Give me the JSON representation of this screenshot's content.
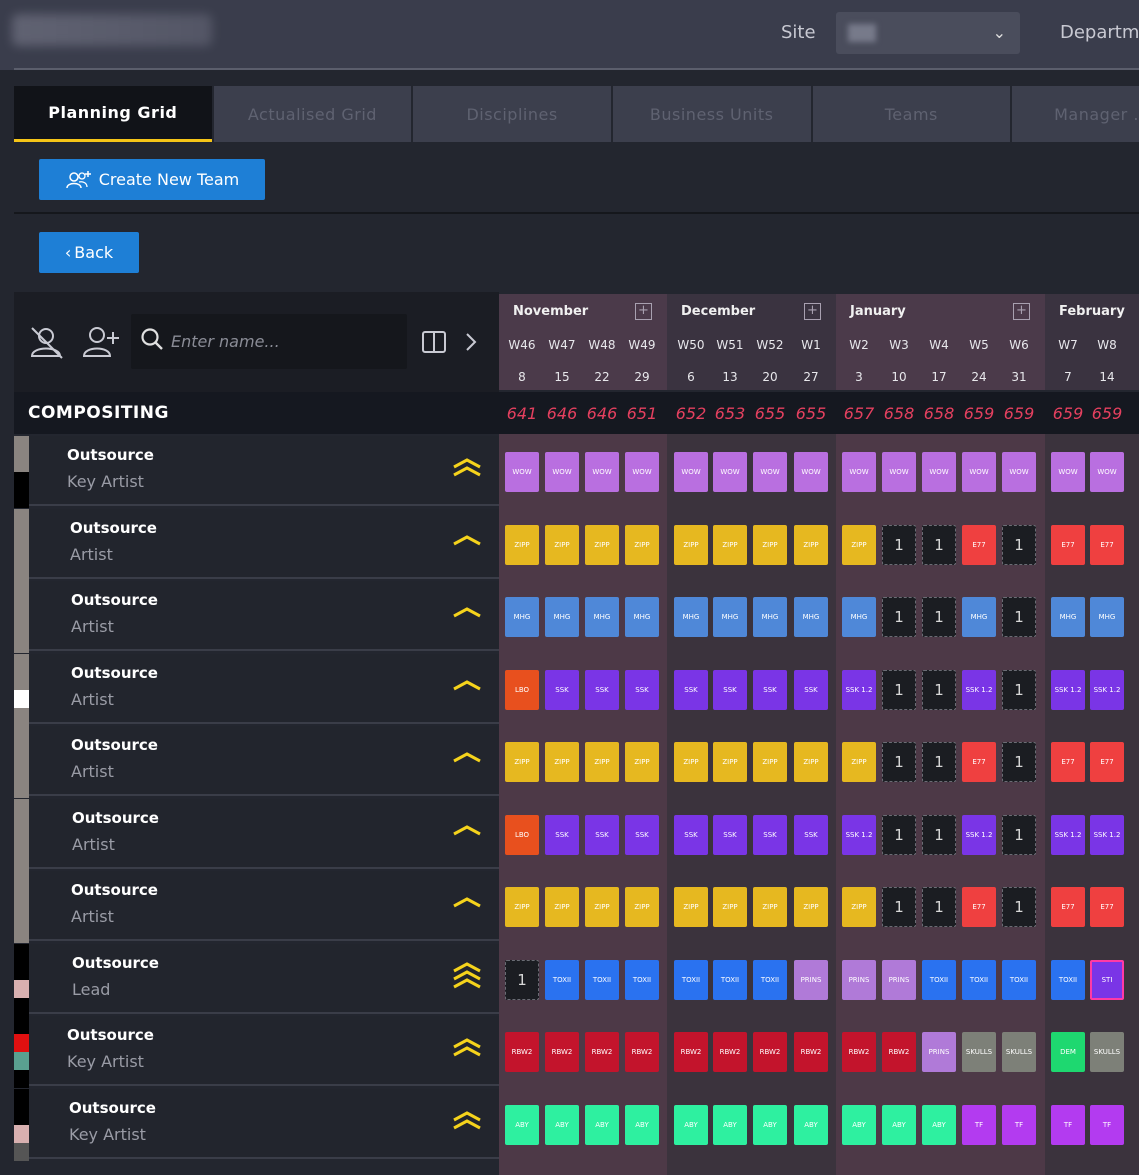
{
  "header": {
    "site_label": "Site",
    "dept_label": "Departme"
  },
  "tabs": [
    "Planning Grid",
    "Actualised Grid",
    "Disciplines",
    "Business Units",
    "Teams",
    "Manager ..."
  ],
  "buttons": {
    "create_team": "Create New Team",
    "back": "Back"
  },
  "search": {
    "placeholder": "Enter name..."
  },
  "months": [
    {
      "name": "November",
      "weeks": [
        "W46",
        "W47",
        "W48",
        "W49"
      ],
      "days": [
        "8",
        "15",
        "22",
        "29"
      ]
    },
    {
      "name": "December",
      "weeks": [
        "W50",
        "W51",
        "W52",
        "W1"
      ],
      "days": [
        "6",
        "13",
        "20",
        "27"
      ]
    },
    {
      "name": "January",
      "weeks": [
        "W2",
        "W3",
        "W4",
        "W5",
        "W6"
      ],
      "days": [
        "3",
        "10",
        "17",
        "24",
        "31"
      ]
    },
    {
      "name": "February",
      "weeks": [
        "W7",
        "W8"
      ],
      "days": [
        "7",
        "14"
      ]
    }
  ],
  "section": {
    "label": "COMPOSITING",
    "counts": [
      "641",
      "646",
      "646",
      "651",
      "652",
      "653",
      "655",
      "655",
      "657",
      "658",
      "658",
      "659",
      "659",
      "659",
      "659"
    ]
  },
  "colors": {
    "wow": "#b96fe0",
    "zipp": "#e6b820",
    "mhg": "#4f88d8",
    "lbo": "#e8501e",
    "ssk": "#7a35e6",
    "e77": "#ef4040",
    "toxi": "#2a72f0",
    "prins": "#b07ad8",
    "rbw": "#c3142c",
    "skulls": "#7d8078",
    "dem": "#1ed870",
    "aby": "#2ef0a0",
    "tf": "#b33bf0"
  },
  "rows": [
    {
      "name": "Outsource",
      "role": "Key Artist",
      "chevron": "double",
      "bars": [
        "#8a8480",
        "#8a8480",
        "#000000",
        "#000000"
      ],
      "cells": [
        [
          "WOW",
          "wow"
        ],
        [
          "WOW",
          "wow"
        ],
        [
          "WOW",
          "wow"
        ],
        [
          "WOW",
          "wow"
        ],
        [
          "WOW",
          "wow"
        ],
        [
          "WOW",
          "wow"
        ],
        [
          "WOW",
          "wow"
        ],
        [
          "WOW",
          "wow"
        ],
        [
          "WOW",
          "wow"
        ],
        [
          "WOW",
          "wow"
        ],
        [
          "WOW",
          "wow"
        ],
        [
          "WOW",
          "wow"
        ],
        [
          "WOW",
          "wow"
        ],
        [
          "WOW",
          "wow"
        ],
        [
          "WOW",
          "wow"
        ]
      ]
    },
    {
      "name": "Outsource",
      "role": "Artist",
      "chevron": "single",
      "bars": [
        "#8a8480",
        "#8a8480",
        "#8a8480",
        "#8a8480"
      ],
      "cells": [
        [
          "ZIPP",
          "zipp"
        ],
        [
          "ZIPP",
          "zipp"
        ],
        [
          "ZIPP",
          "zipp"
        ],
        [
          "ZIPP",
          "zipp"
        ],
        [
          "ZIPP",
          "zipp"
        ],
        [
          "ZIPP",
          "zipp"
        ],
        [
          "ZIPP",
          "zipp"
        ],
        [
          "ZIPP",
          "zipp"
        ],
        [
          "ZIPP",
          "zipp"
        ],
        [
          "1",
          "empty"
        ],
        [
          "1",
          "empty"
        ],
        [
          "E77",
          "e77"
        ],
        [
          "1",
          "empty"
        ],
        [
          "E77",
          "e77"
        ],
        [
          "E77",
          "e77"
        ]
      ]
    },
    {
      "name": "Outsource",
      "role": "Artist",
      "chevron": "single",
      "bars": [
        "#8a8480",
        "#8a8480",
        "#8a8480",
        "#8a8480"
      ],
      "cells": [
        [
          "MHG",
          "mhg"
        ],
        [
          "MHG",
          "mhg"
        ],
        [
          "MHG",
          "mhg"
        ],
        [
          "MHG",
          "mhg"
        ],
        [
          "MHG",
          "mhg"
        ],
        [
          "MHG",
          "mhg"
        ],
        [
          "MHG",
          "mhg"
        ],
        [
          "MHG",
          "mhg"
        ],
        [
          "MHG",
          "mhg"
        ],
        [
          "1",
          "empty"
        ],
        [
          "1",
          "empty"
        ],
        [
          "MHG",
          "mhg"
        ],
        [
          "1",
          "empty"
        ],
        [
          "MHG",
          "mhg"
        ],
        [
          "MHG",
          "mhg"
        ]
      ]
    },
    {
      "name": "Outsource",
      "role": "Artist",
      "chevron": "single",
      "bars": [
        "#8a8480",
        "#8a8480",
        "#ffffff",
        "#8a8480"
      ],
      "cells": [
        [
          "LBO",
          "lbo"
        ],
        [
          "SSK",
          "ssk"
        ],
        [
          "SSK",
          "ssk"
        ],
        [
          "SSK",
          "ssk"
        ],
        [
          "SSK",
          "ssk"
        ],
        [
          "SSK",
          "ssk"
        ],
        [
          "SSK",
          "ssk"
        ],
        [
          "SSK",
          "ssk"
        ],
        [
          "SSK 1.2",
          "ssk"
        ],
        [
          "1",
          "empty"
        ],
        [
          "1",
          "empty"
        ],
        [
          "SSK 1.2",
          "ssk"
        ],
        [
          "1",
          "empty"
        ],
        [
          "SSK 1.2",
          "ssk"
        ],
        [
          "SSK 1.2",
          "ssk"
        ]
      ]
    },
    {
      "name": "Outsource",
      "role": "Artist",
      "chevron": "single",
      "bars": [
        "#8a8480",
        "#8a8480",
        "#8a8480",
        "#8a8480"
      ],
      "cells": [
        [
          "ZIPP",
          "zipp"
        ],
        [
          "ZIPP",
          "zipp"
        ],
        [
          "ZIPP",
          "zipp"
        ],
        [
          "ZIPP",
          "zipp"
        ],
        [
          "ZIPP",
          "zipp"
        ],
        [
          "ZIPP",
          "zipp"
        ],
        [
          "ZIPP",
          "zipp"
        ],
        [
          "ZIPP",
          "zipp"
        ],
        [
          "ZIPP",
          "zipp"
        ],
        [
          "1",
          "empty"
        ],
        [
          "1",
          "empty"
        ],
        [
          "E77",
          "e77"
        ],
        [
          "1",
          "empty"
        ],
        [
          "E77",
          "e77"
        ],
        [
          "E77",
          "e77"
        ]
      ]
    },
    {
      "name": "Outsource",
      "role": "Artist",
      "chevron": "single",
      "bars": [
        "#8a8480",
        "#8a8480",
        "#8a8480",
        "#8a8480"
      ],
      "cells": [
        [
          "LBO",
          "lbo"
        ],
        [
          "SSK",
          "ssk"
        ],
        [
          "SSK",
          "ssk"
        ],
        [
          "SSK",
          "ssk"
        ],
        [
          "SSK",
          "ssk"
        ],
        [
          "SSK",
          "ssk"
        ],
        [
          "SSK",
          "ssk"
        ],
        [
          "SSK",
          "ssk"
        ],
        [
          "SSK 1.2",
          "ssk"
        ],
        [
          "1",
          "empty"
        ],
        [
          "1",
          "empty"
        ],
        [
          "SSK 1.2",
          "ssk"
        ],
        [
          "1",
          "empty"
        ],
        [
          "SSK 1.2",
          "ssk"
        ],
        [
          "SSK 1.2",
          "ssk"
        ]
      ]
    },
    {
      "name": "Outsource",
      "role": "Artist",
      "chevron": "single",
      "bars": [
        "#8a8480",
        "#8a8480",
        "#8a8480",
        "#8a8480"
      ],
      "cells": [
        [
          "ZIPP",
          "zipp"
        ],
        [
          "ZIPP",
          "zipp"
        ],
        [
          "ZIPP",
          "zipp"
        ],
        [
          "ZIPP",
          "zipp"
        ],
        [
          "ZIPP",
          "zipp"
        ],
        [
          "ZIPP",
          "zipp"
        ],
        [
          "ZIPP",
          "zipp"
        ],
        [
          "ZIPP",
          "zipp"
        ],
        [
          "ZIPP",
          "zipp"
        ],
        [
          "1",
          "empty"
        ],
        [
          "1",
          "empty"
        ],
        [
          "E77",
          "e77"
        ],
        [
          "1",
          "empty"
        ],
        [
          "E77",
          "e77"
        ],
        [
          "E77",
          "e77"
        ]
      ]
    },
    {
      "name": "Outsource",
      "role": "Lead",
      "chevron": "triple",
      "bars": [
        "#000000",
        "#000000",
        "#d8b0b0",
        "#000000"
      ],
      "cells": [
        [
          "1",
          "empty"
        ],
        [
          "TOXII",
          "toxi"
        ],
        [
          "TOXII",
          "toxi"
        ],
        [
          "TOXII",
          "toxi"
        ],
        [
          "TOXII",
          "toxi"
        ],
        [
          "TOXII",
          "toxi"
        ],
        [
          "TOXII",
          "toxi"
        ],
        [
          "PRINS",
          "prins"
        ],
        [
          "PRINS",
          "prins"
        ],
        [
          "PRINS",
          "prins"
        ],
        [
          "TOXII",
          "toxi"
        ],
        [
          "TOXII",
          "toxi"
        ],
        [
          "TOXII",
          "toxi"
        ],
        [
          "TOXII",
          "toxi"
        ],
        [
          "STI",
          "pinkbox"
        ]
      ]
    },
    {
      "name": "Outsource",
      "role": "Key Artist",
      "chevron": "double",
      "bars": [
        "#000000",
        "#e01010",
        "#5aa090",
        "#000000"
      ],
      "cells": [
        [
          "RBW2",
          "rbw"
        ],
        [
          "RBW2",
          "rbw"
        ],
        [
          "RBW2",
          "rbw"
        ],
        [
          "RBW2",
          "rbw"
        ],
        [
          "RBW2",
          "rbw"
        ],
        [
          "RBW2",
          "rbw"
        ],
        [
          "RBW2",
          "rbw"
        ],
        [
          "RBW2",
          "rbw"
        ],
        [
          "RBW2",
          "rbw"
        ],
        [
          "RBW2",
          "rbw"
        ],
        [
          "PRINS",
          "prins"
        ],
        [
          "SKULLS",
          "skulls"
        ],
        [
          "SKULLS",
          "skulls"
        ],
        [
          "DEM",
          "dem"
        ],
        [
          "SKULLS",
          "skulls"
        ]
      ]
    },
    {
      "name": "Outsource",
      "role": "Key Artist",
      "chevron": "double",
      "bars": [
        "#000000",
        "#000000",
        "#d8b0b0",
        "#555555"
      ],
      "cells": [
        [
          "ABY",
          "aby"
        ],
        [
          "ABY",
          "aby"
        ],
        [
          "ABY",
          "aby"
        ],
        [
          "ABY",
          "aby"
        ],
        [
          "ABY",
          "aby"
        ],
        [
          "ABY",
          "aby"
        ],
        [
          "ABY",
          "aby"
        ],
        [
          "ABY",
          "aby"
        ],
        [
          "ABY",
          "aby"
        ],
        [
          "ABY",
          "aby"
        ],
        [
          "ABY",
          "aby"
        ],
        [
          "TF",
          "tf"
        ],
        [
          "TF",
          "tf"
        ],
        [
          "TF",
          "tf"
        ],
        [
          "TF",
          "tf"
        ]
      ]
    }
  ]
}
